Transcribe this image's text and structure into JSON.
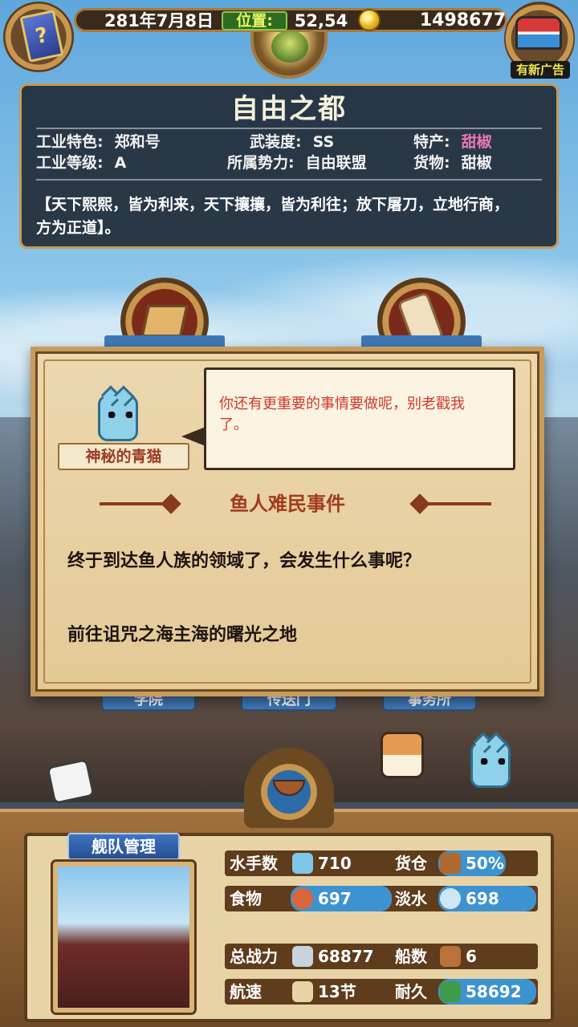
{
  "header": {
    "date": "281年7月8日",
    "position_label": "位置:",
    "position_value": "52,54",
    "gold": "1498677",
    "ad_label": "有新广告"
  },
  "city": {
    "name": "自由之都",
    "industry_feature_label": "工业特色:",
    "industry_feature_value": "郑和号",
    "armament_label": "武装度:",
    "armament_value": "SS",
    "specialty_label": "特产:",
    "specialty_value": "甜椒",
    "industry_level_label": "工业等级:",
    "industry_level_value": "A",
    "faction_label": "所属势力:",
    "faction_value": "自由联盟",
    "goods_label": "货物:",
    "goods_value": "甜椒",
    "description_line1": "【天下熙熙，皆为利来，天下攘攘，皆为利往；放下屠刀，立地行商，",
    "description_line2": "方为正道】。"
  },
  "dialog": {
    "speaker": "神秘的青猫",
    "bubble_line1": "你还有更重要的事情要做呢，别老戳我",
    "bubble_line2": "了。",
    "event_title": "鱼人难民事件",
    "line1": "终于到达鱼人族的领域了，会发生什么事呢？",
    "line2": "前往诅咒之海主海的曙光之地"
  },
  "buildings": {
    "label_left": "学院",
    "label_mid": "传送门",
    "label_right": "事务所"
  },
  "fleet": {
    "title": "舰队管理",
    "sailors_label": "水手数",
    "sailors_value": "710",
    "cargo_label": "货仓",
    "cargo_value": "50%",
    "food_label": "食物",
    "food_value": "697",
    "water_label": "淡水",
    "water_value": "698",
    "power_label": "总战力",
    "power_value": "68877",
    "ships_label": "船数",
    "ships_value": "6",
    "speed_label": "航速",
    "speed_value": "13节",
    "durability_label": "耐久",
    "durability_value": "58692"
  },
  "colors": {
    "accent_gold": "#c89a52",
    "stat_blue": "#3d93cf",
    "event_red": "#a23a1f",
    "bubble_red": "#d0392b",
    "specialty_pink": "#e678b6"
  }
}
